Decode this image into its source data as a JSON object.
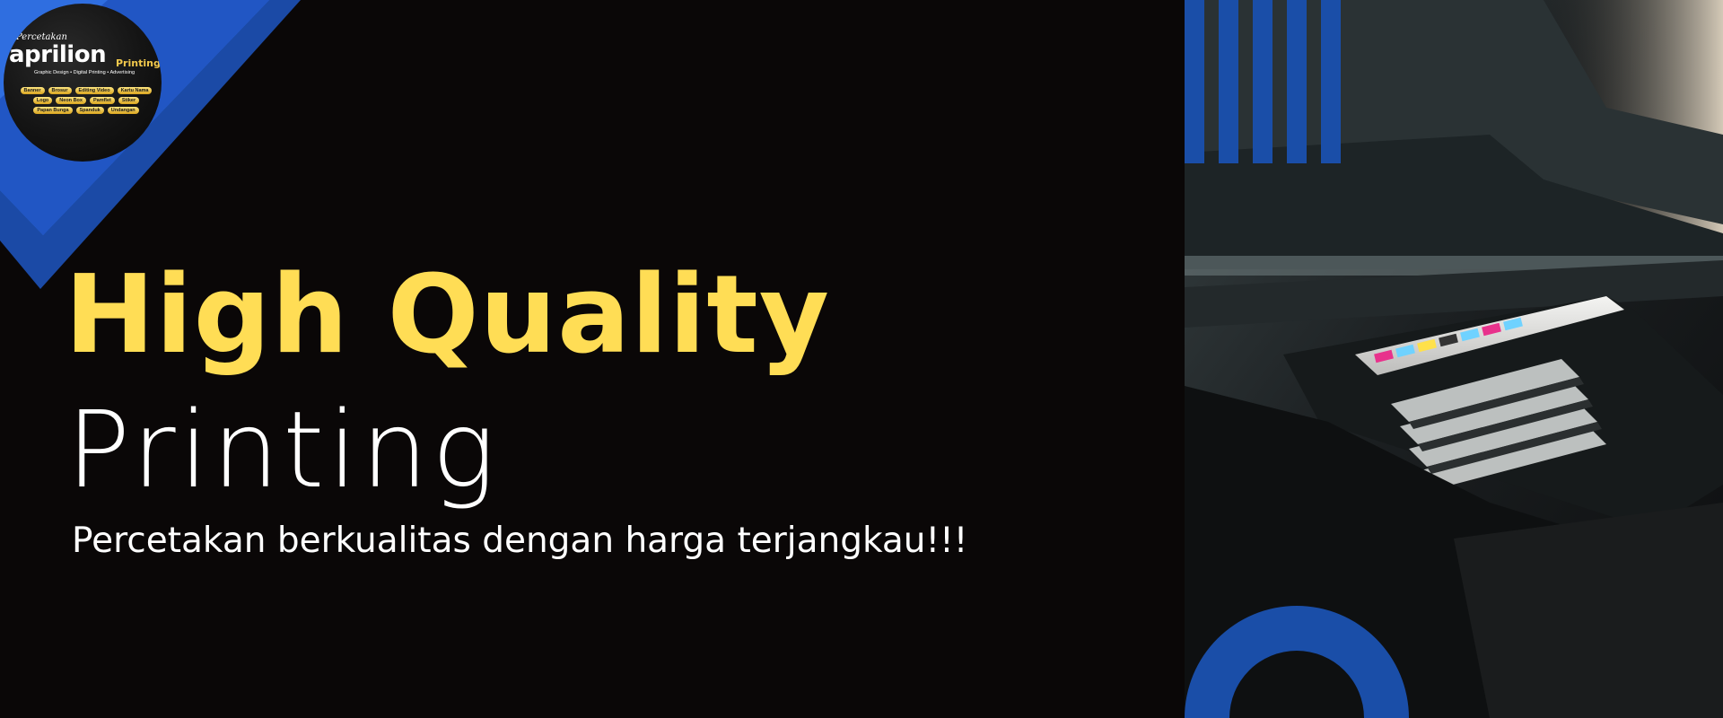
{
  "logo": {
    "script": "Percetakan",
    "wordmark": "aprilion",
    "sub": "Printing",
    "tagline": "Graphic Design • Digital Printing • Advertising",
    "services": [
      "Banner",
      "Brosur",
      "Editing Video",
      "Kartu Nama",
      "Logo",
      "Neon Box",
      "Pamflet",
      "Stiker",
      "Papan Bunga",
      "Spanduk",
      "Undangan"
    ]
  },
  "headline": {
    "line1": "High Quality",
    "line2": "Printing"
  },
  "tagline": "Percetakan berkualitas dengan harga terjangkau!!!",
  "photo": {
    "cartridge_labels": [
      "M",
      "PC",
      "Y",
      "BK",
      "C",
      "PM",
      "C"
    ]
  },
  "colors": {
    "background": "#0a0707",
    "accent_blue": "#1a4ea8",
    "headline_yellow": "#ffdd55",
    "text_white": "#ffffff"
  }
}
